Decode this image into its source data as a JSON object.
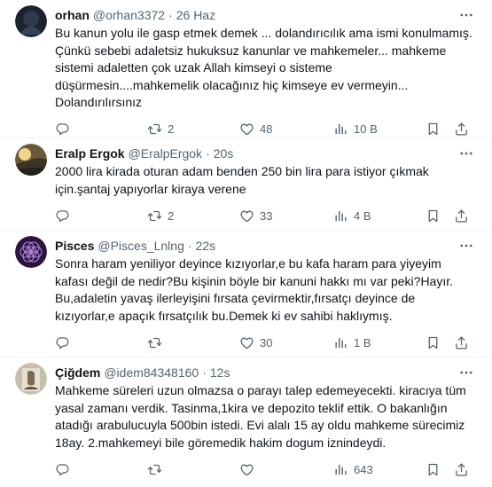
{
  "tweets": [
    {
      "name": "orhan",
      "handle": "@orhan3372",
      "dot": "·",
      "time": "26 Haz",
      "text": "Bu kanun yolu ile gasp etmek demek ... dolandırıcılık ama ismi konulmamış.\nÇünkü sebebi adaletsiz hukuksuz kanunlar ve mahkemeler... mahkeme\nsistemi adaletten çok uzak Allah kimseyi o sisteme\ndüşürmesin....mahkemelik olacağınız hiç kimseye ev vermeyin...\nDolandırılırsınız",
      "replies": "",
      "retweets": "2",
      "likes": "48",
      "views": "10 B"
    },
    {
      "name": "Eralp Ergok",
      "handle": "@EralpErgok",
      "dot": "·",
      "time": "20s",
      "text": "2000 lira kirada oturan adam benden 250 bin lira para istiyor çıkmak\niçin.şantaj yapıyorlar kiraya verene",
      "replies": "",
      "retweets": "2",
      "likes": "33",
      "views": "4 B"
    },
    {
      "name": "Pisces",
      "handle": "@Pisces_Lnlng",
      "dot": "·",
      "time": "22s",
      "text": "Sonra haram yeniliyor deyince kızıyorlar,e bu kafa haram para yiyeyim\nkafası değil de nedir?Bu kişinin böyle bir kanuni hakkı mı var peki?Hayır.\nBu,adaletin yavaş ilerleyişini fırsata çevirmektir,fırsatçı deyince de\nkızıyorlar,e apaçık fırsatçılık bu.Demek ki ev sahibi haklıymış.",
      "replies": "",
      "retweets": "",
      "likes": "30",
      "views": "1 B"
    },
    {
      "name": "Çiğdem",
      "handle": "@idem84348160",
      "dot": "·",
      "time": "12s",
      "text": "Mahkeme süreleri uzun olmazsa o parayı talep edemeyecekti. kiracıya tüm\nyasal zamanı verdik. Tasinma,1kira ve depozito teklif ettik. O bakanlığın\natadığı arabulucuyla 500bin  istedi. Evi alalı 15 ay oldu mahkeme sürecimiz\n18ay. 2.mahkemeyi bile göremedik hakim dogum iznindeydi.",
      "replies": "",
      "retweets": "",
      "likes": "",
      "views": "643"
    }
  ],
  "icons": {
    "more": "more-icon",
    "reply": "reply-icon",
    "retweet": "retweet-icon",
    "like": "heart-icon",
    "views": "views-icon",
    "bookmark": "bookmark-icon",
    "share": "share-icon"
  },
  "colors": {
    "text": "#0f1419",
    "secondary": "#536471",
    "divider": "#eff3f4"
  }
}
